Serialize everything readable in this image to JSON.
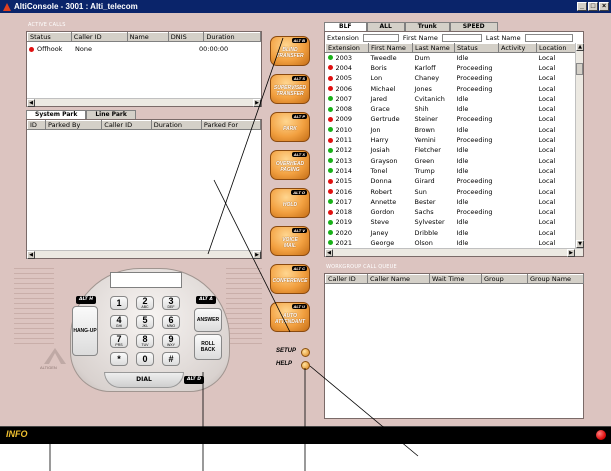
{
  "window": {
    "title": "AltiConsole - 3001 : Alti_telecom",
    "minimize": "_",
    "maximize": "□",
    "close": "×"
  },
  "colors": {
    "online": "#18b018",
    "busy": "#e01010",
    "button_orange": "#f2a040"
  },
  "active_calls": {
    "label": "ACTIVE CALLS",
    "headers": [
      "Status",
      "Caller ID",
      "Name",
      "DNIS",
      "Duration"
    ],
    "rows": [
      [
        "Offhook",
        "None",
        "",
        "",
        "00:00:00"
      ]
    ]
  },
  "park": {
    "tabs": [
      "System Park",
      "Line Park"
    ],
    "headers": [
      "ID",
      "Parked By",
      "Caller ID",
      "Duration",
      "Parked For"
    ]
  },
  "actions": [
    {
      "label1": "BLIND",
      "label2": "TRANSFER",
      "alt": "ALT B"
    },
    {
      "label1": "SUPERVISED",
      "label2": "TRANSFER",
      "alt": "ALT S"
    },
    {
      "label1": "PARK",
      "label2": "",
      "alt": "ALT P"
    },
    {
      "label1": "OVERHEAD",
      "label2": "PAGING",
      "alt": "ALT X"
    },
    {
      "label1": "HOLD",
      "label2": "",
      "alt": "ALT O"
    },
    {
      "label1": "VOICE",
      "label2": "MAIL",
      "alt": "ALT V"
    },
    {
      "label1": "CONFERENCE",
      "label2": "",
      "alt": "ALT C"
    },
    {
      "label1": "AUTO",
      "label2": "ATTENDANT",
      "alt": "ALT U"
    }
  ],
  "setup": {
    "setup_label": "SETUP",
    "help_label": "HELP"
  },
  "directory": {
    "tabs": [
      "BLF",
      "ALL",
      "Trunk",
      "SPEED"
    ],
    "filters": {
      "extension": "Extension",
      "first_name": "First Name",
      "last_name": "Last Name"
    },
    "headers": [
      "Extension",
      "First Name",
      "Last Name",
      "Status",
      "Activity",
      "Location"
    ],
    "rows": [
      {
        "status_color": "#18b018",
        "ext": "2003",
        "first": "Tweedle",
        "last": "Dum",
        "status": "Idle",
        "activity": "",
        "location": "Local"
      },
      {
        "status_color": "#e01010",
        "ext": "2004",
        "first": "Boris",
        "last": "Karloff",
        "status": "Proceeding",
        "activity": "",
        "location": "Local"
      },
      {
        "status_color": "#e01010",
        "ext": "2005",
        "first": "Lon",
        "last": "Chaney",
        "status": "Proceeding",
        "activity": "",
        "location": "Local"
      },
      {
        "status_color": "#e01010",
        "ext": "2006",
        "first": "Michael",
        "last": "Jones",
        "status": "Proceeding",
        "activity": "",
        "location": "Local"
      },
      {
        "status_color": "#18b018",
        "ext": "2007",
        "first": "Jared",
        "last": "Cvitanich",
        "status": "Idle",
        "activity": "",
        "location": "Local"
      },
      {
        "status_color": "#18b018",
        "ext": "2008",
        "first": "Grace",
        "last": "Shih",
        "status": "Idle",
        "activity": "",
        "location": "Local"
      },
      {
        "status_color": "#e01010",
        "ext": "2009",
        "first": "Gertrude",
        "last": "Steiner",
        "status": "Proceeding",
        "activity": "",
        "location": "Local"
      },
      {
        "status_color": "#18b018",
        "ext": "2010",
        "first": "Jon",
        "last": "Brown",
        "status": "Idle",
        "activity": "",
        "location": "Local"
      },
      {
        "status_color": "#e01010",
        "ext": "2011",
        "first": "Harry",
        "last": "Yemini",
        "status": "Proceeding",
        "activity": "",
        "location": "Local"
      },
      {
        "status_color": "#18b018",
        "ext": "2012",
        "first": "Josiah",
        "last": "Fletcher",
        "status": "Idle",
        "activity": "",
        "location": "Local"
      },
      {
        "status_color": "#18b018",
        "ext": "2013",
        "first": "Grayson",
        "last": "Green",
        "status": "Idle",
        "activity": "",
        "location": "Local"
      },
      {
        "status_color": "#18b018",
        "ext": "2014",
        "first": "Tonel",
        "last": "Trump",
        "status": "Idle",
        "activity": "",
        "location": "Local"
      },
      {
        "status_color": "#e01010",
        "ext": "2015",
        "first": "Donna",
        "last": "Girard",
        "status": "Proceeding",
        "activity": "",
        "location": "Local"
      },
      {
        "status_color": "#e01010",
        "ext": "2016",
        "first": "Robert",
        "last": "Sun",
        "status": "Proceeding",
        "activity": "",
        "location": "Local"
      },
      {
        "status_color": "#18b018",
        "ext": "2017",
        "first": "Annette",
        "last": "Bester",
        "status": "Idle",
        "activity": "",
        "location": "Local"
      },
      {
        "status_color": "#e01010",
        "ext": "2018",
        "first": "Gordon",
        "last": "Sachs",
        "status": "Proceeding",
        "activity": "",
        "location": "Local"
      },
      {
        "status_color": "#18b018",
        "ext": "2019",
        "first": "Steve",
        "last": "Sylvester",
        "status": "Idle",
        "activity": "",
        "location": "Local"
      },
      {
        "status_color": "#18b018",
        "ext": "2020",
        "first": "Janey",
        "last": "Dribble",
        "status": "Idle",
        "activity": "",
        "location": "Local"
      },
      {
        "status_color": "#18b018",
        "ext": "2021",
        "first": "George",
        "last": "Olson",
        "status": "Idle",
        "activity": "",
        "location": "Local"
      }
    ]
  },
  "workgroup": {
    "label": "WORKGROUP CALL QUEUE",
    "headers": [
      "Caller ID",
      "Caller Name",
      "Wait Time",
      "Group",
      "Group Name"
    ]
  },
  "phone": {
    "keys": [
      {
        "d": "1",
        "s": ""
      },
      {
        "d": "2",
        "s": "ABC"
      },
      {
        "d": "3",
        "s": "DEF"
      },
      {
        "d": "4",
        "s": "GHI"
      },
      {
        "d": "5",
        "s": "JKL"
      },
      {
        "d": "6",
        "s": "MNO"
      },
      {
        "d": "7",
        "s": "PRS"
      },
      {
        "d": "8",
        "s": "TUV"
      },
      {
        "d": "9",
        "s": "WXY"
      },
      {
        "d": "*",
        "s": ""
      },
      {
        "d": "0",
        "s": ""
      },
      {
        "d": "#",
        "s": ""
      }
    ],
    "hangup": "HANG-UP",
    "answer": "ANSWER",
    "rollback1": "ROLL",
    "rollback2": "BACK",
    "dial": "DIAL",
    "alt_h": "ALT H",
    "alt_a": "ALT A",
    "alt_d": "ALT D",
    "brand": "ALTIGEN"
  },
  "info": {
    "label": "INFO"
  }
}
